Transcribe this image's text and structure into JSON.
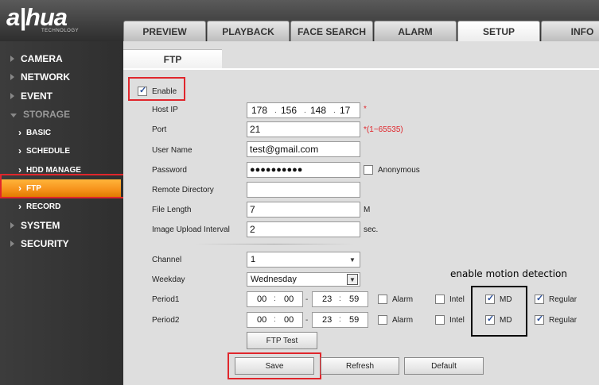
{
  "brand": {
    "logo": "a|hua",
    "sub": "TECHNOLOGY"
  },
  "tabs": [
    {
      "label": "PREVIEW"
    },
    {
      "label": "PLAYBACK"
    },
    {
      "label": "FACE SEARCH"
    },
    {
      "label": "ALARM"
    },
    {
      "label": "SETUP"
    },
    {
      "label": "INFO"
    }
  ],
  "sidebar": {
    "camera": "CAMERA",
    "network": "NETWORK",
    "event": "EVENT",
    "storage": "STORAGE",
    "basic": "BASIC",
    "schedule": "SCHEDULE",
    "hdd": "HDD MANAGE",
    "ftp": "FTP",
    "record": "RECORD",
    "system": "SYSTEM",
    "security": "SECURITY"
  },
  "page": {
    "title": "FTP"
  },
  "form": {
    "enable_label": "Enable",
    "host_ip_label": "Host IP",
    "host_ip": [
      "178",
      "156",
      "148",
      "17"
    ],
    "host_star": "*",
    "port_label": "Port",
    "port_value": "21",
    "port_note": "*(1~65535)",
    "user_label": "User Name",
    "user_value": "test@gmail.com",
    "password_label": "Password",
    "password_value": "●●●●●●●●●●",
    "anonymous_label": "Anonymous",
    "remote_dir_label": "Remote Directory",
    "remote_dir_value": "",
    "file_length_label": "File Length",
    "file_length_value": "7",
    "file_length_unit": "M",
    "upload_interval_label": "Image Upload Interval",
    "upload_interval_value": "2",
    "upload_interval_unit": "sec.",
    "channel_label": "Channel",
    "channel_value": "1",
    "weekday_label": "Weekday",
    "weekday_value": "Wednesday",
    "period1_label": "Period1",
    "period2_label": "Period2",
    "period_start": [
      "00",
      "00"
    ],
    "period_end": [
      "23",
      "59"
    ],
    "alarm_label": "Alarm",
    "intel_label": "Intel",
    "md_label": "MD",
    "regular_label": "Regular"
  },
  "buttons": {
    "ftp_test": "FTP Test",
    "save": "Save",
    "refresh": "Refresh",
    "default": "Default"
  },
  "annotation": {
    "md_text": "enable motion detection"
  },
  "colors": {
    "accent": "#f7941d",
    "highlight": "#e0262c"
  }
}
